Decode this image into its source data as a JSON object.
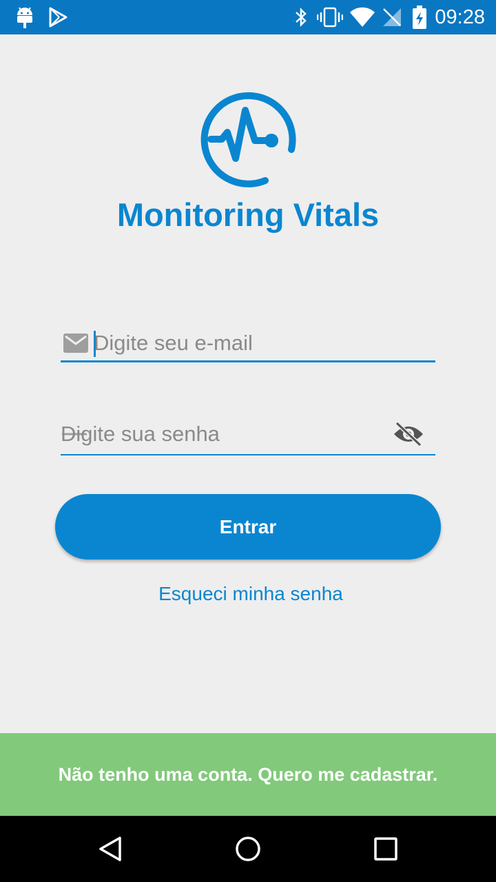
{
  "status_bar": {
    "time": "09:28",
    "icons": [
      "android-icon",
      "play-store-icon",
      "bluetooth-icon",
      "vibrate-icon",
      "wifi-icon",
      "no-signal-icon",
      "battery-charging-icon"
    ]
  },
  "app": {
    "title": "Monitoring Vitals",
    "logo": "heartbeat-logo-icon"
  },
  "login": {
    "email_placeholder": "Digite seu e-mail",
    "email_value": "",
    "password_placeholder": "Digite sua senha",
    "password_value": "",
    "enter_label": "Entrar",
    "forgot_label": "Esqueci minha senha"
  },
  "register": {
    "label": "Não tenho uma conta. Quero me cadastrar."
  },
  "nav": {
    "buttons": [
      "back-icon",
      "home-icon",
      "recents-icon"
    ]
  },
  "colors": {
    "primary": "#0a86d0",
    "status_bar": "#0a77c2",
    "background": "#eeeeee",
    "register_bar": "#82c97b"
  }
}
